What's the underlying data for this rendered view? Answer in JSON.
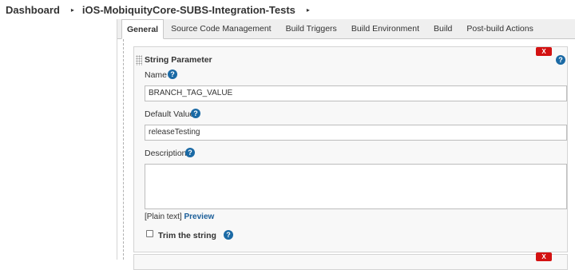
{
  "breadcrumb": {
    "items": [
      "Dashboard",
      "iOS-MobiquityCore-SUBS-Integration-Tests"
    ],
    "separator": "▸"
  },
  "tabs": [
    {
      "label": "General",
      "active": true
    },
    {
      "label": "Source Code Management",
      "active": false
    },
    {
      "label": "Build Triggers",
      "active": false
    },
    {
      "label": "Build Environment",
      "active": false
    },
    {
      "label": "Build",
      "active": false
    },
    {
      "label": "Post-build Actions",
      "active": false
    }
  ],
  "parameter": {
    "title": "String Parameter",
    "delete_label": "X",
    "help_glyph": "?",
    "name_label": "Name",
    "name_value": "BRANCH_TAG_VALUE",
    "default_label": "Default Value",
    "default_value": "releaseTesting",
    "description_label": "Description",
    "description_value": "",
    "hint_prefix": "[Plain text]",
    "hint_link": "Preview",
    "trim_label": "Trim the string",
    "trim_checked": false
  },
  "colors": {
    "delete_button": "#d31212",
    "help_icon": "#1b6aa5",
    "link": "#1b5e99"
  }
}
